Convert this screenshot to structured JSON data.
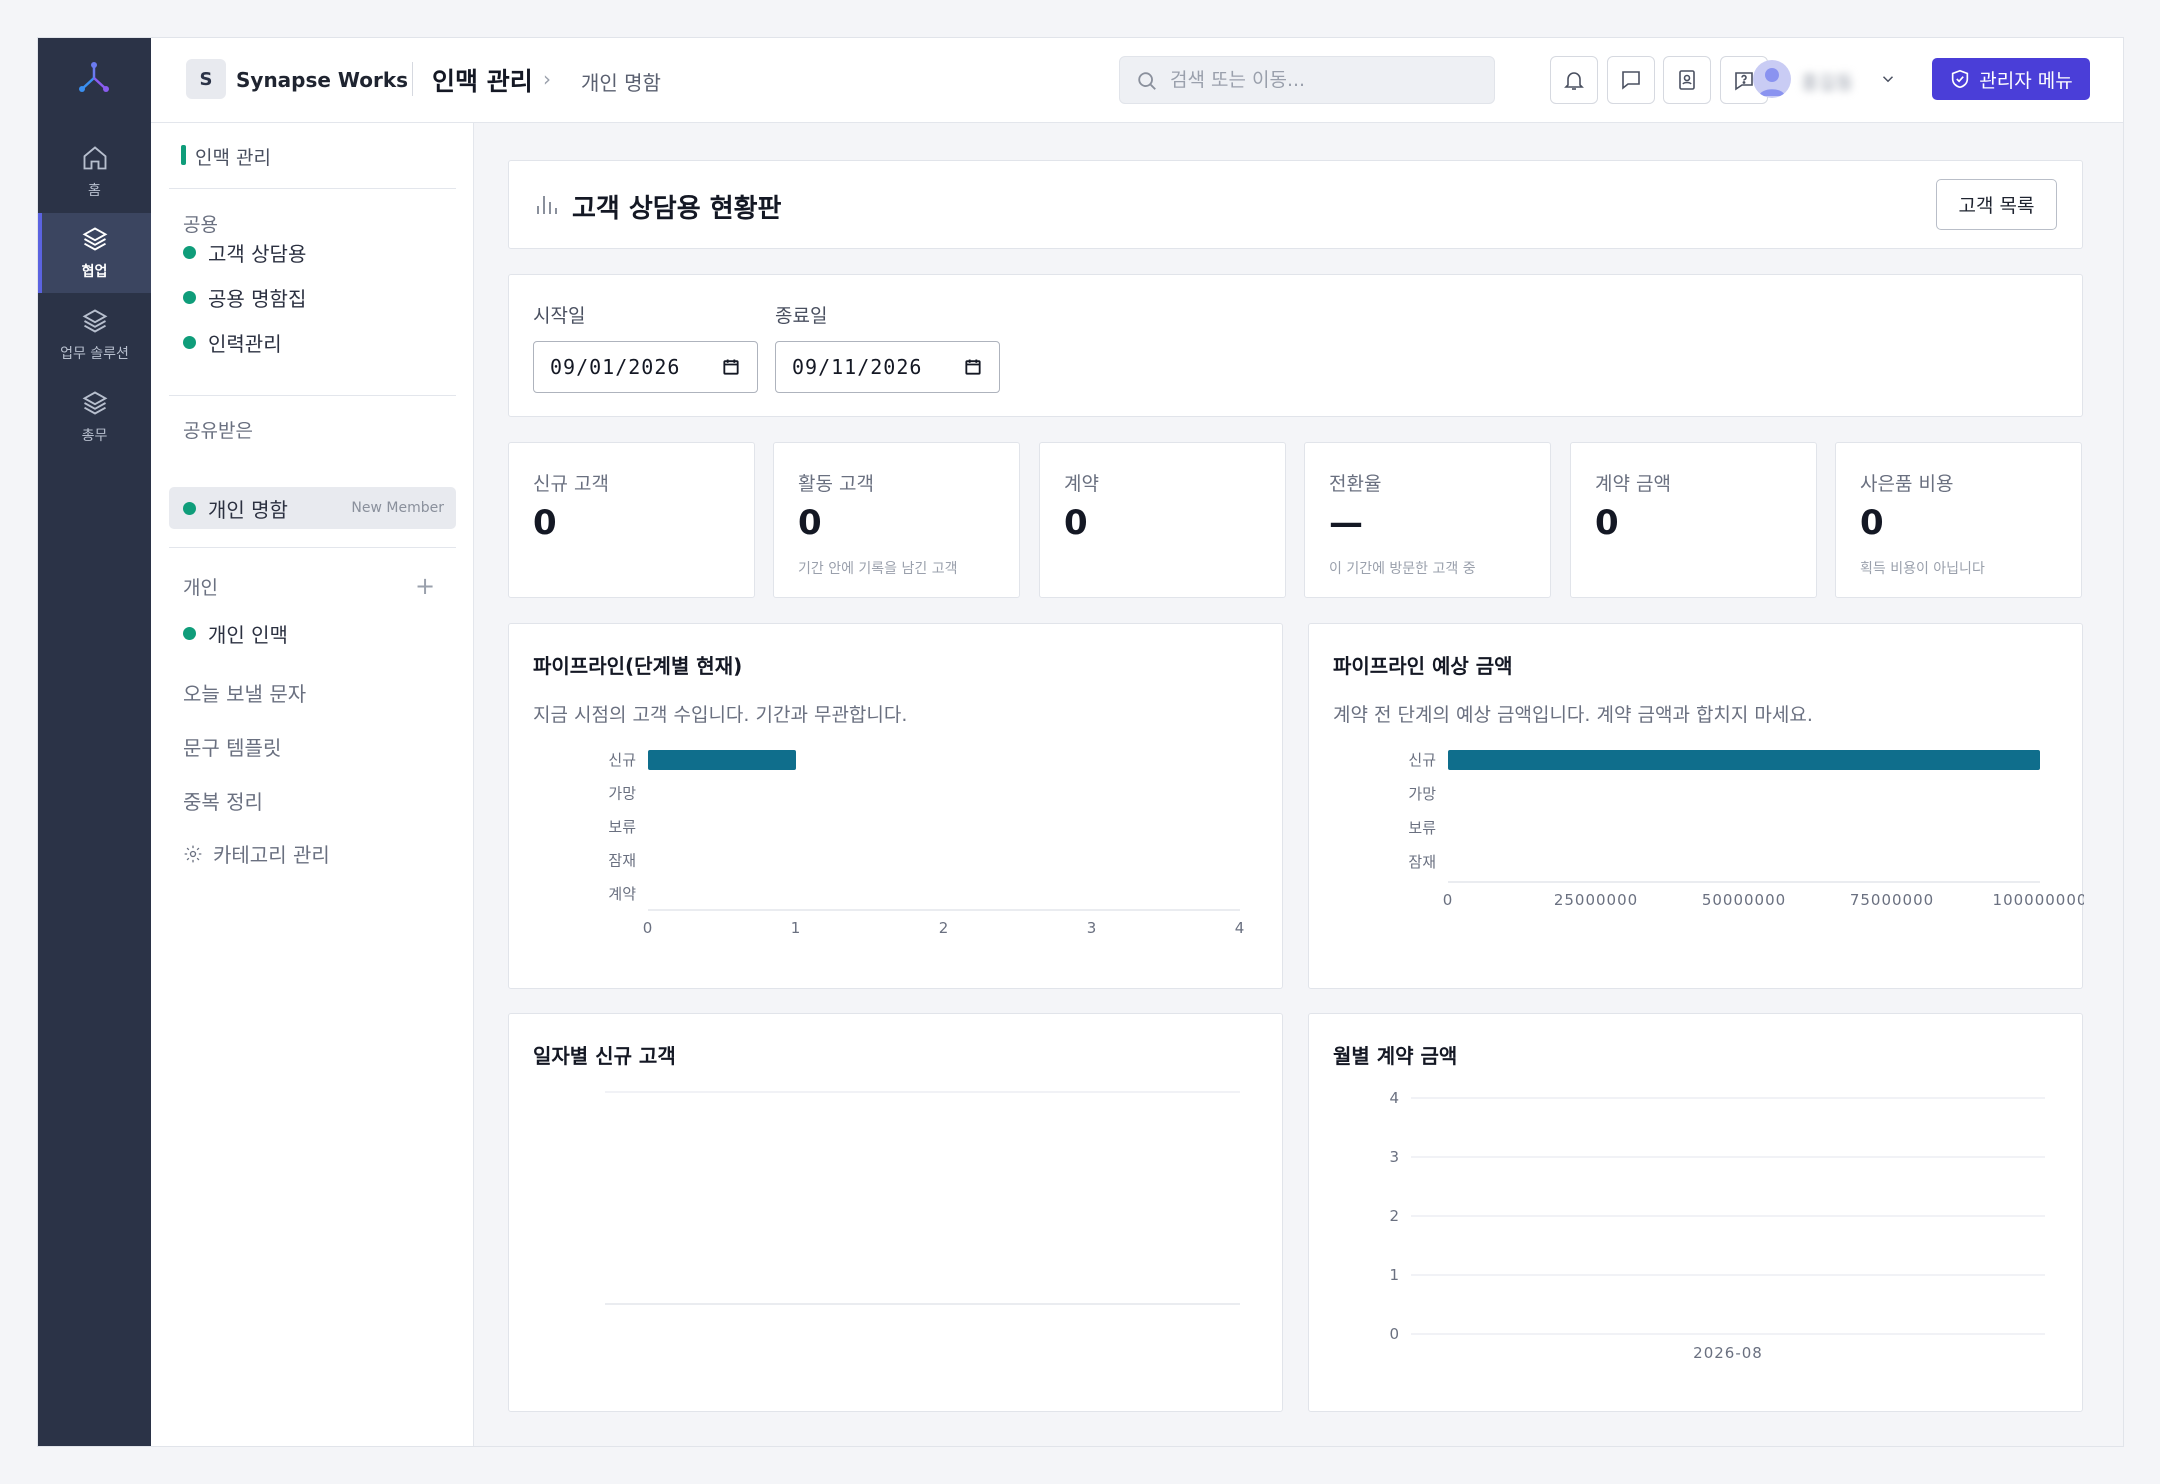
{
  "workspace": {
    "initial": "S",
    "name": "Synapse Works"
  },
  "breadcrumb": {
    "main": "인맥 관리",
    "sub": "개인 명함"
  },
  "search": {
    "placeholder": "검색 또는 이동..."
  },
  "user": {
    "name": "홍길동"
  },
  "admin_button": "관리자 메뉴",
  "rail": [
    {
      "label": "홈",
      "icon": "home-icon"
    },
    {
      "label": "협업",
      "icon": "layers-icon",
      "active": true
    },
    {
      "label": "업무 솔루션",
      "icon": "layers-icon"
    },
    {
      "label": "총무",
      "icon": "layers-icon"
    }
  ],
  "sidebar": {
    "header": "인맥 관리",
    "group_shared": "공용",
    "shared_items": [
      "고객 상담용",
      "공용 명함집",
      "인력관리"
    ],
    "group_received": "공유받은",
    "received_item": {
      "label": "개인 명함",
      "tag": "New Member"
    },
    "group_personal": "개인",
    "personal_item": "개인 인맥",
    "links": [
      "오늘 보낼 문자",
      "문구 템플릿",
      "중복 정리",
      "카테고리 관리"
    ]
  },
  "page": {
    "title": "고객 상담용 현황판",
    "list_button": "고객 목록"
  },
  "filters": {
    "start_label": "시작일",
    "start_value": "09/01/2026",
    "end_label": "종료일",
    "end_value": "09/11/2026"
  },
  "stats": [
    {
      "label": "신규 고객",
      "value": "0",
      "sub": ""
    },
    {
      "label": "활동 고객",
      "value": "0",
      "sub": "기간 안에 기록을 남긴 고객"
    },
    {
      "label": "계약",
      "value": "0",
      "sub": ""
    },
    {
      "label": "전환율",
      "value": "—",
      "sub": "이 기간에 방문한 고객 중"
    },
    {
      "label": "계약 금액",
      "value": "0",
      "sub": ""
    },
    {
      "label": "사은품 비용",
      "value": "0",
      "sub": "획득 비용이 아닙니다"
    }
  ],
  "colors": {
    "bar": "#0f6e8c",
    "accent": "#4a3ed8",
    "dot": "#0f9d7a"
  },
  "chart_data": [
    {
      "type": "bar",
      "orientation": "horizontal",
      "title": "파이프라인(단계별 현재)",
      "subtitle": "지금 시점의 고객 수입니다. 기간과 무관합니다.",
      "categories": [
        "신규",
        "가망",
        "보류",
        "잠재",
        "계약"
      ],
      "values": [
        1,
        0,
        0,
        0,
        0
      ],
      "xlim": [
        0,
        4
      ],
      "xticks": [
        0,
        1,
        2,
        3,
        4
      ]
    },
    {
      "type": "bar",
      "orientation": "horizontal",
      "title": "파이프라인 예상 금액",
      "subtitle": "계약 전 단계의 예상 금액입니다. 계약 금액과 합치지 마세요.",
      "categories": [
        "신규",
        "가망",
        "보류",
        "잠재"
      ],
      "values": [
        100000000,
        0,
        0,
        0
      ],
      "xlim": [
        0,
        100000000
      ],
      "xticks": [
        0,
        25000000,
        50000000,
        75000000,
        100000000
      ]
    },
    {
      "type": "line",
      "title": "일자별 신규 고객",
      "x": [],
      "values": []
    },
    {
      "type": "bar",
      "title": "월별 계약 금액",
      "categories": [
        "2026-08"
      ],
      "values": [
        0
      ],
      "ylim": [
        0,
        4
      ],
      "yticks": [
        0,
        1,
        2,
        3,
        4
      ]
    }
  ]
}
